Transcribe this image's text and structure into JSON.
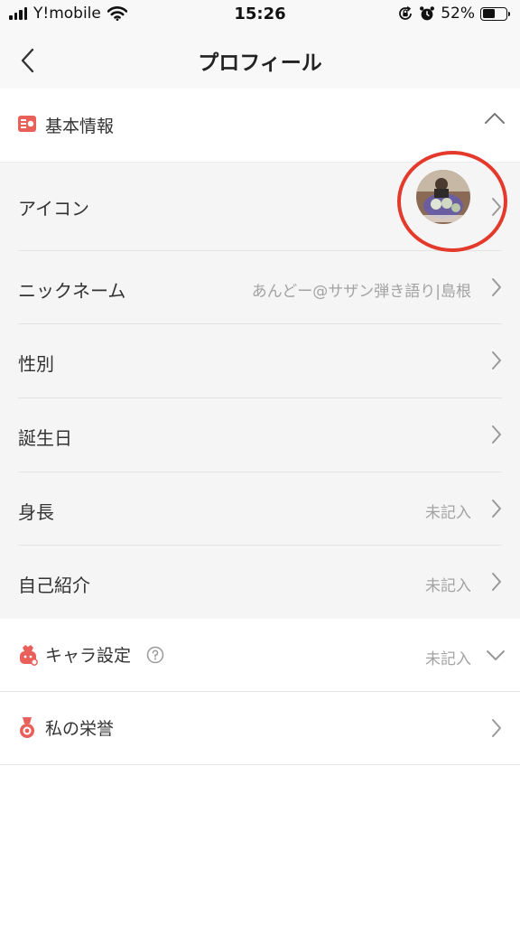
{
  "status_bar": {
    "carrier": "Y!mobile",
    "time": "15:26",
    "battery": "52%",
    "battery_level": 0.52
  },
  "nav": {
    "title": "プロフィール"
  },
  "basic_info": {
    "title": "基本情報",
    "rows": [
      {
        "label": "アイコン",
        "value": ""
      },
      {
        "label": "ニックネーム",
        "value": "あんどー@サザン弾き語り|島根"
      },
      {
        "label": "性別",
        "value": ""
      },
      {
        "label": "誕生日",
        "value": ""
      },
      {
        "label": "身長",
        "value": "未記入"
      },
      {
        "label": "自己紹介",
        "value": "未記入"
      }
    ]
  },
  "chara": {
    "label": "キャラ設定",
    "value": "未記入"
  },
  "honor": {
    "label": "私の栄誉"
  },
  "colors": {
    "accent": "#e9605a",
    "highlight": "#e33a2c"
  }
}
